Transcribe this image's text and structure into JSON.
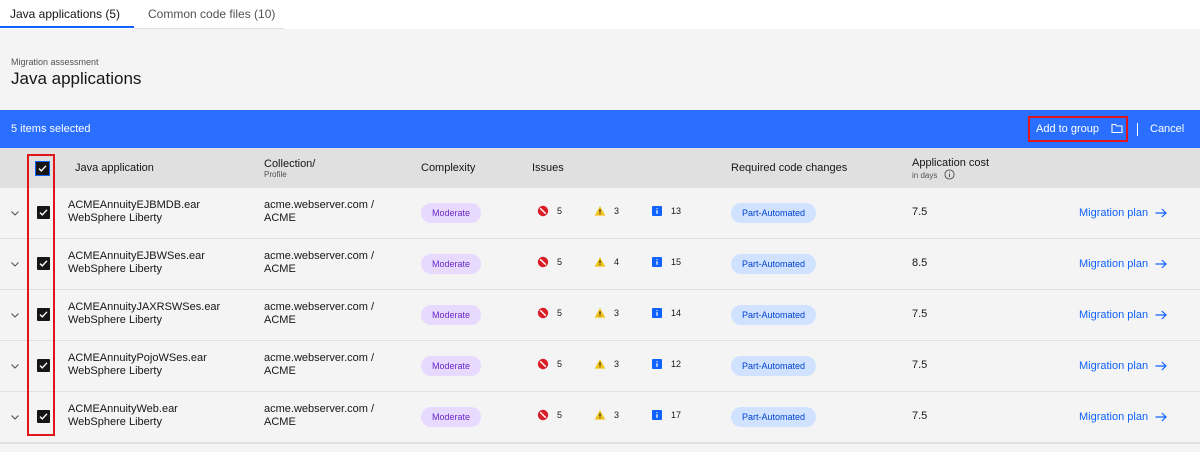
{
  "tabs": [
    {
      "label": "Java applications (5)"
    },
    {
      "label": "Common code files (10)"
    }
  ],
  "header": {
    "breadcrumb": "Migration assessment",
    "title": "Java applications"
  },
  "batch": {
    "selected_text": "5 items selected",
    "add_to_group": "Add to group",
    "cancel": "Cancel"
  },
  "columns": {
    "app": "Java application",
    "collection": "Collection/",
    "collection_sub": "Profile",
    "complexity": "Complexity",
    "issues": "Issues",
    "code_changes": "Required code changes",
    "cost": "Application cost",
    "cost_sub": "in days"
  },
  "colors": {
    "accent": "#0f62fe",
    "batch_bar": "#2a6fff",
    "highlight": "#e0161a",
    "critical": "#da1e28",
    "warning": "#f1c21b"
  },
  "rows": [
    {
      "name": "ACMEAnnuityEJBMDB.ear",
      "runtime": "WebSphere Liberty",
      "collection": "acme.webserver.com /",
      "profile": "ACME",
      "complexity": "Moderate",
      "critical": "5",
      "warning": "3",
      "info": "13",
      "changes": "Part-Automated",
      "cost": "7.5",
      "action": "Migration plan"
    },
    {
      "name": "ACMEAnnuityEJBWSes.ear",
      "runtime": "WebSphere Liberty",
      "collection": "acme.webserver.com /",
      "profile": "ACME",
      "complexity": "Moderate",
      "critical": "5",
      "warning": "4",
      "info": "15",
      "changes": "Part-Automated",
      "cost": "8.5",
      "action": "Migration plan"
    },
    {
      "name": "ACMEAnnuityJAXRSWSes.ear",
      "runtime": "WebSphere Liberty",
      "collection": "acme.webserver.com /",
      "profile": "ACME",
      "complexity": "Moderate",
      "critical": "5",
      "warning": "3",
      "info": "14",
      "changes": "Part-Automated",
      "cost": "7.5",
      "action": "Migration plan"
    },
    {
      "name": "ACMEAnnuityPojoWSes.ear",
      "runtime": "WebSphere Liberty",
      "collection": "acme.webserver.com /",
      "profile": "ACME",
      "complexity": "Moderate",
      "critical": "5",
      "warning": "3",
      "info": "12",
      "changes": "Part-Automated",
      "cost": "7.5",
      "action": "Migration plan"
    },
    {
      "name": "ACMEAnnuityWeb.ear",
      "runtime": "WebSphere Liberty",
      "collection": "acme.webserver.com /",
      "profile": "ACME",
      "complexity": "Moderate",
      "critical": "5",
      "warning": "3",
      "info": "17",
      "changes": "Part-Automated",
      "cost": "7.5",
      "action": "Migration plan"
    }
  ]
}
